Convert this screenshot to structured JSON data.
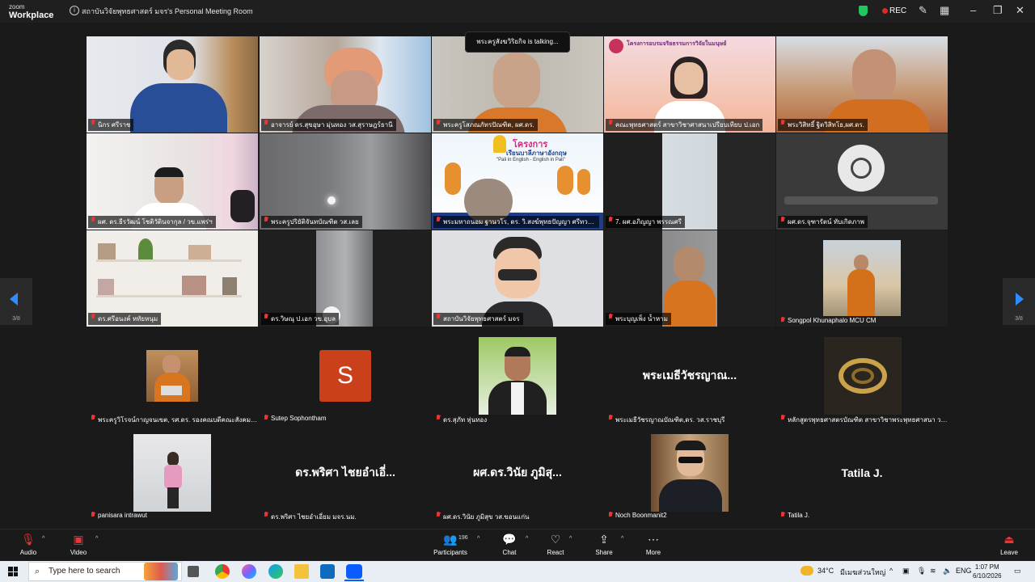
{
  "window": {
    "brand_top": "zoom",
    "brand_bottom": "Workplace",
    "title": "สถาบันวิจัยพุทธศาสตร์ มจร's Personal Meeting Room",
    "rec_label": "REC"
  },
  "talking": "พระครูสังฆวิริยกิจ  is talking...",
  "pager": {
    "left": "3/8",
    "right": "3/8"
  },
  "video_tiles": [
    {
      "label": "นิกร ศรีราช"
    },
    {
      "label": "อาจารย์ ดร.สุขอุษา มุ่นทอง วส.สุราษฎร์ธานี"
    },
    {
      "label": "พระครูโสภณภัทรปัณฑิต, ผศ.ดร."
    },
    {
      "label": "คณะพุทธศาสตร์ สาขาวิชาศาสนาเปรียบเทียบ ป.เอก"
    },
    {
      "label": "พระวิสิทธิ์ ฐิตวิสิทโธ,ผศ.ดร."
    },
    {
      "label": "ผศ. ดร.ธีรวัฒน์  โชติวัตินจากุล / วข.แพร่ฯ"
    },
    {
      "label": "พระครูปริยัติจันทบัณฑิต วส.เลย"
    },
    {
      "label": "พระมหาถนอม ฐานวโร, ดร. วิ.สงฆ์พุทธปัญญา ศรีทวารวดี"
    },
    {
      "label": "7. ผศ.อภิญญา  พรรณศรี"
    },
    {
      "label": "ผศ.ดร.จุฑารัตน์ ทับเกิดภาพ"
    },
    {
      "label": "ดร.ศรีอนงค์ หทัยหนุม"
    },
    {
      "label": "ดร.วิษณุ ป.เอก วข.อุบล"
    },
    {
      "label": "สถาบันวิจัยพุทธศาสตร์ มจร"
    },
    {
      "label": "พระบุญเพ็ง น้ำหาม"
    },
    {
      "label": "Songpol Khunaphalo MCU CM"
    }
  ],
  "slide_texts": {
    "slide1": "โครงการอบรมจริยธรรมการวิจัยในมนุษย์",
    "slide2_title": "โครงการ",
    "slide2_sub": "เรียนบาลีภาษาอังกฤษ",
    "slide2_tag": "\"Pali in English - English in Pali\""
  },
  "avatar_tiles": [
    {
      "label": "พระครูวิโรจน์กาญจนเขต, รศ.ดร. รองคณบดีคณะสังคมศาสตร์"
    },
    {
      "label": "Sutep Sophontham",
      "initial": "S"
    },
    {
      "label": "ดร.สุภัท หุ่นทอง"
    },
    {
      "label": "พระเมธีวัชรญาณบัณฑิต,ดร. วส.ราชบุรี",
      "big": "พระเมธีวัชรญาณ..."
    },
    {
      "label": "หลักสูตรพุทธศาสตรบัณฑิต สาขาวิชาพระพุทธศาสนา วส..."
    }
  ],
  "row6_tiles": [
    {
      "label": "panisara intrawut"
    },
    {
      "label": "ดร.พริศา ไชยอำเอี่ยม มจร.นม.",
      "big": "ดร.พริศา ไชยอำเอี่..."
    },
    {
      "label": "ผศ.ดร.วินัย ภูมิสุข วส.ขอนแก่น",
      "big": "ผศ.ดร.วินัย  ภูมิสุ..."
    },
    {
      "label": "Noch Boonmanit2"
    },
    {
      "label": "Tatila J.",
      "big": "Tatila J."
    }
  ],
  "toolbar": {
    "audio": "Audio",
    "video": "Video",
    "participants": "Participants",
    "participants_count": "196",
    "chat": "Chat",
    "react": "React",
    "share": "Share",
    "more": "More",
    "leave": "Leave"
  },
  "taskbar": {
    "search_placeholder": "Type here to search",
    "weather": "34°C",
    "weather_desc": "มีเมฆส่วนใหญ่",
    "lang": "ENG",
    "time": "1:07 PM",
    "date": "6/10/2026"
  },
  "colors": {
    "accent": "#0b5cff",
    "rec": "#e02828",
    "shield": "#22c55e",
    "avatar_orange": "#c9401b",
    "pager_arrow": "#2f8cff"
  }
}
